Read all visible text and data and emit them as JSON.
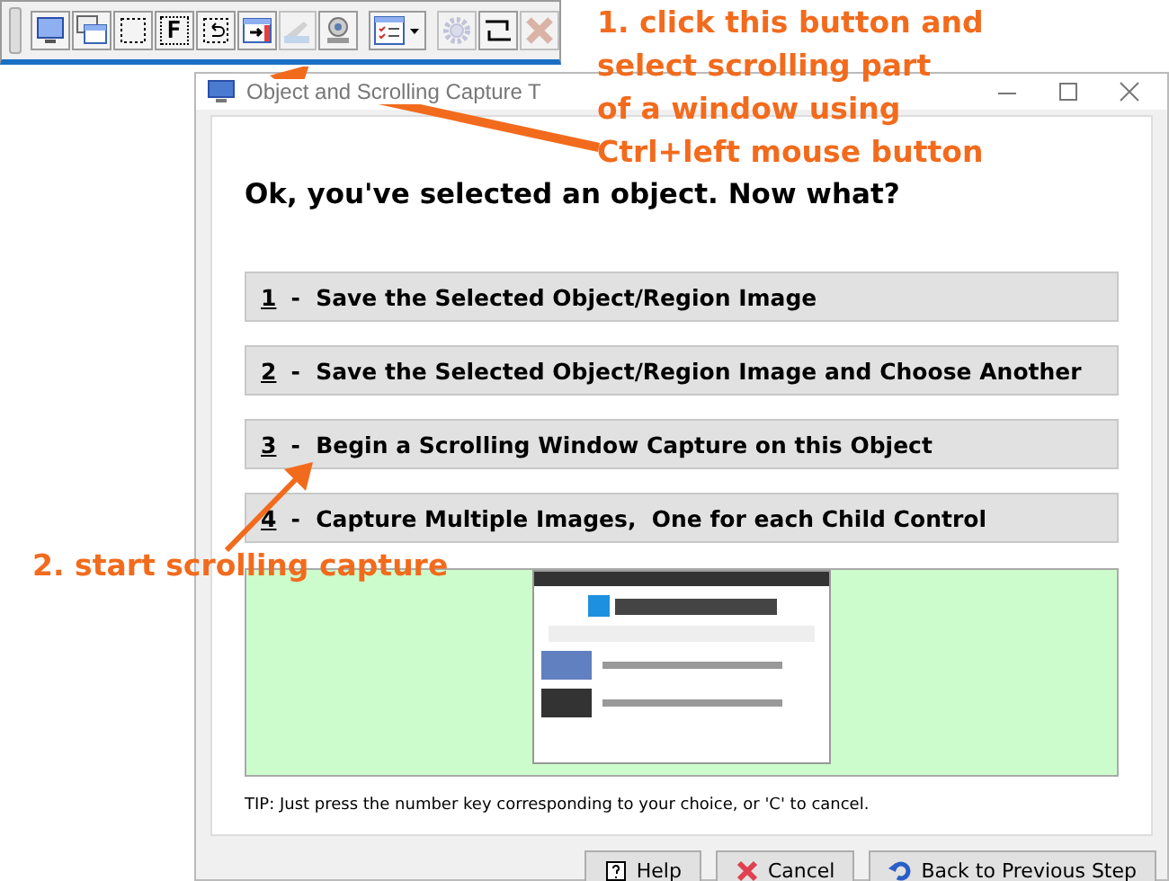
{
  "toolbar": {
    "items": [
      {
        "kind": "screen",
        "disabled": false
      },
      {
        "kind": "window",
        "disabled": false
      },
      {
        "kind": "region",
        "disabled": false
      },
      {
        "kind": "fixed",
        "label": "F",
        "disabled": false
      },
      {
        "kind": "repeat",
        "disabled": false
      },
      {
        "kind": "scroll",
        "disabled": false
      },
      {
        "kind": "scanner",
        "disabled": true
      },
      {
        "kind": "webcam",
        "disabled": false
      },
      {
        "kind": "menu",
        "disabled": false
      },
      {
        "kind": "gear",
        "disabled": true
      },
      {
        "kind": "split",
        "disabled": false
      },
      {
        "kind": "close",
        "disabled": true
      }
    ]
  },
  "window": {
    "title": "Object and Scrolling Capture T",
    "heading": "Ok, you've selected an object.  Now what?",
    "options": [
      {
        "key": "1",
        "label": "-  Save the Selected Object/Region Image"
      },
      {
        "key": "2",
        "label": "-  Save the Selected Object/Region Image and Choose Another"
      },
      {
        "key": "3",
        "label": "-  Begin a Scrolling Window Capture on this Object"
      },
      {
        "key": "4",
        "label": "-  Capture Multiple Images,  One for each Child Control"
      }
    ],
    "tip": "TIP: Just press the number key corresponding to your choice, or 'C' to cancel.",
    "buttons": [
      {
        "kind": "help",
        "label": "Help"
      },
      {
        "kind": "cancel",
        "label": "Cancel"
      },
      {
        "kind": "back",
        "label": "Back to Previous Step"
      }
    ]
  },
  "annotations": [
    {
      "kind": "toolbar-note",
      "lines": [
        "1. click this button and",
        "select scrolling part",
        "of a window using",
        "Ctrl+left mouse button"
      ]
    },
    {
      "kind": "option-note",
      "lines": [
        "2. start scrolling capture"
      ]
    }
  ]
}
